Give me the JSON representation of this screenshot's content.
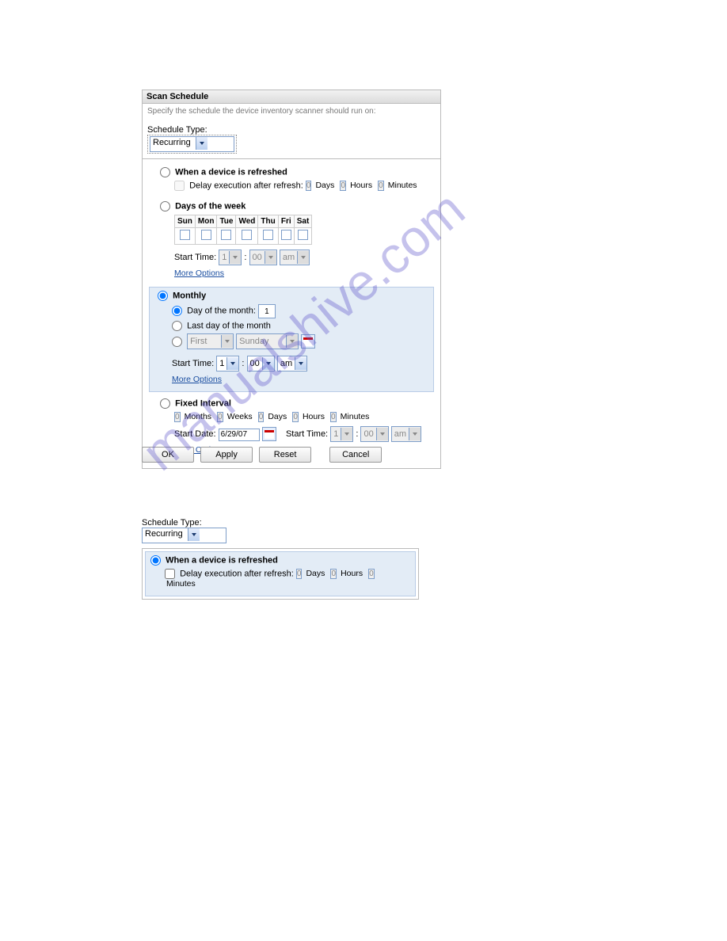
{
  "header_title": "Scan Schedule",
  "description": "Specify the schedule the device inventory scanner should run on:",
  "schedule_type_label": "Schedule Type:",
  "schedule_type_value": "Recurring",
  "section_refresh": {
    "title": "When a device is refreshed",
    "delay_label": "Delay execution after refresh:",
    "days": "0",
    "days_label": "Days",
    "hours": "0",
    "hours_label": "Hours",
    "minutes": "0",
    "minutes_label": "Minutes"
  },
  "section_dow": {
    "title": "Days of the week",
    "headers": [
      "Sun",
      "Mon",
      "Tue",
      "Wed",
      "Thu",
      "Fri",
      "Sat"
    ],
    "start_time_label": "Start Time:",
    "hour": "1",
    "minute": "00",
    "ampm": "am",
    "more_options": "More Options"
  },
  "section_monthly": {
    "title": "Monthly",
    "day_of_month_label": "Day of the month:",
    "day_of_month_value": "1",
    "last_day_label": "Last day of the month",
    "ordinal": "First",
    "weekday": "Sunday",
    "start_time_label": "Start Time:",
    "hour": "1",
    "minute": "00",
    "ampm": "am",
    "more_options": "More Options"
  },
  "section_fixed": {
    "title": "Fixed Interval",
    "months": "0",
    "months_label": "Months",
    "weeks": "0",
    "weeks_label": "Weeks",
    "days": "0",
    "days_label": "Days",
    "hours": "0",
    "hours_label": "Hours",
    "minutes": "0",
    "minutes_label": "Minutes",
    "start_date_label": "Start Date:",
    "start_date_value": "6/29/07",
    "start_time_label": "Start Time:",
    "hour": "1",
    "minute": "00",
    "ampm": "am",
    "more_options": "More Options"
  },
  "buttons": {
    "ok": "OK",
    "apply": "Apply",
    "reset": "Reset",
    "cancel": "Cancel"
  },
  "watermark": "manualshive.com"
}
